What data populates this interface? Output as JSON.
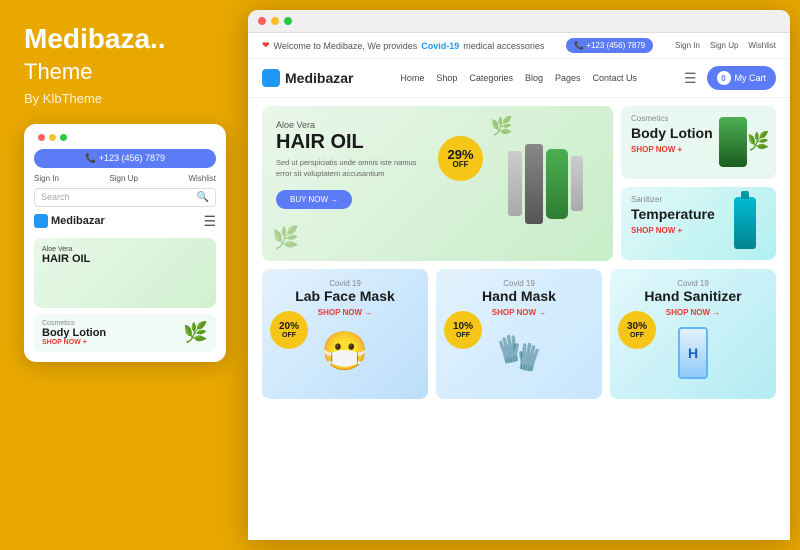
{
  "left": {
    "title": "Medibaza..",
    "subtitle": "Theme",
    "by": "By KlbTheme",
    "mobile": {
      "dots": [
        "red",
        "yellow",
        "green"
      ],
      "phone_number": "📞 +123 (456) 7879",
      "sign_in": "Sign In",
      "sign_up": "Sign Up",
      "wishlist": "Wishlist",
      "search_placeholder": "Search",
      "brand": "Medibazar",
      "hero_small": "Aloe Vera",
      "hero_title": "HAIR OIL",
      "card_category": "Cosmetics",
      "card_title": "Body Lotion",
      "card_shop": "SHOP NOW +"
    }
  },
  "browser": {
    "topbar": {
      "welcome": "Welcome to Medibaze, We provides",
      "covid": "Covid-19",
      "medical": "medical accessories",
      "phone": "+123 (456) 7879",
      "sign_in": "Sign In",
      "sign_up": "Sign Up",
      "wishlist": "Wishlist"
    },
    "nav": {
      "brand": "Medibazar",
      "links": [
        "Home",
        "Shop",
        "Categories",
        "Blog",
        "Pages",
        "Contact Us"
      ],
      "cart_count": "0",
      "cart_label": "My Cart"
    },
    "hero": {
      "small_text": "Aloe Vera",
      "title": "HAIR OIL",
      "description": "Sed ut perspiciatis unde omnis iste namus error sit voluptatem accusantium",
      "badge_percent": "29%",
      "badge_off": "OFF",
      "btn": "BUY NOW →"
    },
    "right_banners": [
      {
        "category": "Cosmetics",
        "title": "Body Lotion",
        "shop": "SHOP NOW +"
      },
      {
        "category": "Sanitizer",
        "title": "Temperature",
        "shop": "SHOP NOW +"
      }
    ],
    "products": [
      {
        "category": "Covid 19",
        "title": "Lab Face Mask",
        "shop": "SHOP NOW →",
        "discount": "20%",
        "off": "OFF"
      },
      {
        "category": "Covid 19",
        "title": "Hand Mask",
        "shop": "SHOP NOW →",
        "discount": "10%",
        "off": "OFF"
      },
      {
        "category": "Covid 19",
        "title": "Hand Sanitizer",
        "shop": "SHOP NOW →",
        "discount": "30%",
        "off": "OFF"
      }
    ]
  }
}
